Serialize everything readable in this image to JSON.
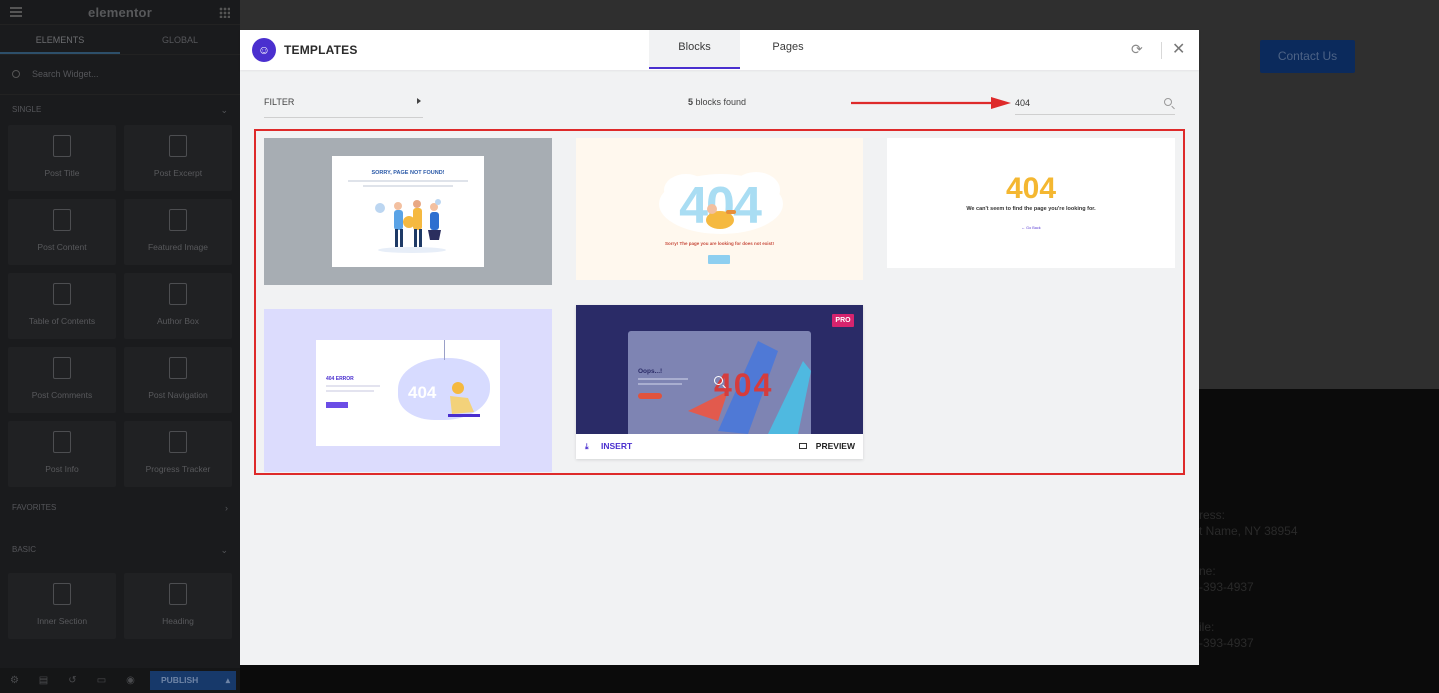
{
  "panel": {
    "logo": "elementor",
    "tabs": [
      "ELEMENTS",
      "GLOBAL"
    ],
    "search_placeholder": "Search Widget...",
    "categories": {
      "single": "SINGLE",
      "favorites": "FAVORITES",
      "basic": "BASIC"
    },
    "single_widgets": [
      "Post Title",
      "Post Excerpt",
      "Post Content",
      "Featured Image",
      "Table of Contents",
      "Author Box",
      "Post Comments",
      "Post Navigation",
      "Post Info",
      "Progress Tracker"
    ],
    "basic_widgets": [
      "Inner Section",
      "Heading"
    ],
    "publish_label": "PUBLISH"
  },
  "page": {
    "contact_button": "Contact Us",
    "address_label": "ress:",
    "address_value": "t Name, NY 38954",
    "phone_label": "ne:",
    "phone_value": "-393-4937",
    "mobile_label": "ile:",
    "mobile_value": "-393-4937"
  },
  "modal": {
    "title": "TEMPLATES",
    "tabs": {
      "blocks": "Blocks",
      "pages": "Pages"
    },
    "filter_label": "FILTER",
    "found_count": "5",
    "found_text": "blocks found",
    "search_value": "404",
    "accent_color": "#4a2fcf",
    "highlight_color": "#de2a2a",
    "cards": [
      {
        "heading": "SORRY, PAGE NOT FOUND!"
      },
      {
        "big": "404",
        "sub": "Sorry! The page you are looking for does not exist!"
      },
      {
        "big": "404",
        "sub": "We can't seem to find the page you're looking for.",
        "link": "← Go Back"
      },
      {
        "label": "404 ERROR",
        "big": "404"
      },
      {
        "title": "Oops...!",
        "big": "404",
        "badge": "PRO",
        "insert_label": "INSERT",
        "preview_label": "PREVIEW"
      }
    ]
  }
}
